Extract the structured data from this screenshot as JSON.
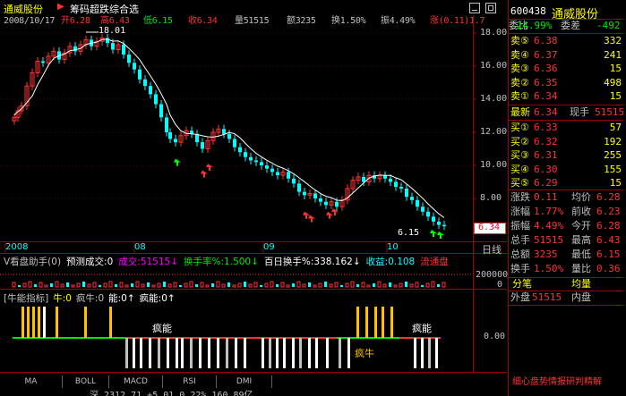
{
  "title_bar": {
    "stock_name": "通威股份",
    "indicator_name": "筹码超跌综合选"
  },
  "info_bar": {
    "date": "2008/10/17",
    "open": "开6.28",
    "high": "高6.43",
    "low": "低6.15",
    "close": "收6.34",
    "volume": "量51515",
    "amount": "额3235",
    "turnover": "换1.50%",
    "amplitude": "振4.49%",
    "change": "涨(0.11)1.7"
  },
  "main_chart": {
    "y_ticks": [
      "18.00",
      "16.00",
      "14.00",
      "12.00",
      "10.00",
      "8.00"
    ],
    "high_label": "18.01",
    "low_label": "6.15",
    "current_price": "6.34",
    "x_labels": [
      "2008",
      "08",
      "09",
      "10"
    ],
    "right_mode_label": "日线",
    "colors": {
      "up": "#ff3232",
      "down": "#00ffff",
      "ma": "#ffffff"
    }
  },
  "volume_panel": {
    "legend": [
      {
        "t": "V看盘助手(0)",
        "c": "#c0c0c0"
      },
      {
        "t": "预测成交:0",
        "c": "#ffffff"
      },
      {
        "t": "成交:51515↓",
        "c": "#ff00ff"
      },
      {
        "t": "换手率%:1.500↓",
        "c": "#00e600"
      },
      {
        "t": "百日换手%:338.162↓",
        "c": "#ffffff"
      },
      {
        "t": "收益:0.108",
        "c": "#00ffff"
      },
      {
        "t": "流通盘",
        "c": "#ff3232"
      }
    ],
    "y_tick": "200000",
    "bottom_tick": "0"
  },
  "niu_panel": {
    "legend": [
      {
        "t": "[牛能指标]",
        "c": "#c0c0c0"
      },
      {
        "t": "牛:0",
        "c": "#ffff00"
      },
      {
        "t": "疯牛:0",
        "c": "#c0c0c0"
      },
      {
        "t": "能:0↑",
        "c": "#ffffff"
      },
      {
        "t": "疯能:0↑",
        "c": "#ffffff"
      }
    ],
    "y_tick": "0.00",
    "annotations": [
      "疯能",
      "疯能",
      "疯牛"
    ]
  },
  "tabs": [
    "MA",
    "BOLL",
    "MACD",
    "RSI",
    "DMI"
  ],
  "right_panel": {
    "code": "600438",
    "name": "通威股份",
    "weibi_label": "委比",
    "weibi_value": "-24.99%",
    "weicha_label": "委差",
    "weicha_value": "-492",
    "sells": [
      {
        "label": "卖⑤",
        "price": "6.38",
        "vol": "332"
      },
      {
        "label": "卖④",
        "price": "6.37",
        "vol": "241"
      },
      {
        "label": "卖③",
        "price": "6.36",
        "vol": "15"
      },
      {
        "label": "卖②",
        "price": "6.35",
        "vol": "498"
      },
      {
        "label": "卖①",
        "price": "6.34",
        "vol": "15"
      }
    ],
    "latest_label": "最新",
    "latest_value": "6.34",
    "now_label": "现手",
    "now_value": "51515",
    "buys": [
      {
        "label": "买①",
        "price": "6.33",
        "vol": "57"
      },
      {
        "label": "买②",
        "price": "6.32",
        "vol": "192"
      },
      {
        "label": "买③",
        "price": "6.31",
        "vol": "255"
      },
      {
        "label": "买④",
        "price": "6.30",
        "vol": "155"
      },
      {
        "label": "买⑤",
        "price": "6.29",
        "vol": "15"
      }
    ],
    "stats": [
      {
        "l1": "涨跌",
        "v1": "0.11",
        "l2": "均价",
        "v2": "6.28"
      },
      {
        "l1": "涨幅",
        "v1": "1.77%",
        "l2": "前收",
        "v2": "6.23"
      },
      {
        "l1": "振幅",
        "v1": "4.49%",
        "l2": "今开",
        "v2": "6.28"
      },
      {
        "l1": "总手",
        "v1": "51515",
        "l2": "最高",
        "v2": "6.43"
      },
      {
        "l1": "总额",
        "v1": "3235",
        "l2": "最低",
        "v2": "6.15"
      },
      {
        "l1": "换手",
        "v1": "1.50%",
        "l2": "量比",
        "v2": "0.36"
      }
    ],
    "fenbi": "分笔",
    "junliang": "均量",
    "waipan_label": "外盘",
    "waipan_value": "51515",
    "neipan_label": "内盘",
    "footer_text": "细心盘势情报研判精解"
  },
  "window_controls": [
    "minimize",
    "maximize"
  ],
  "bottom_partial": "深 2312.71 +5.01 0.22% 160.89亿"
}
